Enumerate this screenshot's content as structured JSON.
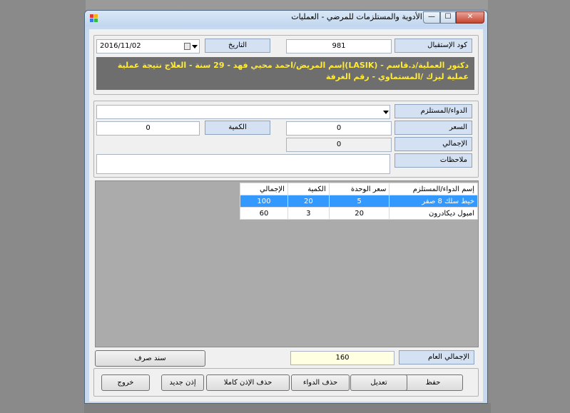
{
  "window": {
    "title": "تسجيل الأدوية والمستلزمات للمرضي - العمليات",
    "minimize_glyph": "—",
    "maximize_glyph": "☐",
    "close_glyph": "✕",
    "icon": "app-grid-icon"
  },
  "header": {
    "reception_code_label": "كود الإستقبال",
    "reception_code_value": "981",
    "date_label": "التاريخ",
    "date_value": "2016/11/02",
    "banner_text": "دكتور العملية/د.قاسم - (LASIK)إسم المريض/احمد محيي فهد - 29 سنة - العلاج نتيجة عملية عملية ليزك /المستماوي - رقم الغرفة"
  },
  "form": {
    "drug_label": "الدواء/المستلزم",
    "drug_value": "",
    "price_label": "السعر",
    "price_value": "0",
    "quantity_label": "الكمية",
    "quantity_value": "0",
    "total_label": "الإجمالي",
    "total_value": "0",
    "notes_label": "ملاحظات",
    "notes_value": ""
  },
  "grid": {
    "columns": [
      "إسم الدواء/المستلزم",
      "سعر الوحدة",
      "الكمية",
      "الإجمالي"
    ],
    "rows": [
      {
        "name": "خيط سلك 8 صفر",
        "unit_price": "5",
        "quantity": "20",
        "total": "100",
        "selected": true
      },
      {
        "name": "امبول ديكادرون",
        "unit_price": "20",
        "quantity": "3",
        "total": "60",
        "selected": false
      }
    ]
  },
  "footer": {
    "grand_total_label": "الإجمالي العام",
    "grand_total_value": "160",
    "voucher_button": "سند صرف"
  },
  "actions": {
    "save": "حفظ",
    "edit": "تعديل",
    "delete_drug": "حذف الدواء",
    "delete_permit": "حذف الإذن كاملا",
    "new_permit": "إذن جديد",
    "exit": "خروج"
  },
  "colors": {
    "banner_bg": "#6e6e6e",
    "banner_text": "#ffeb3b",
    "selection": "#3399ff",
    "label_bg": "#d4e1f2"
  }
}
